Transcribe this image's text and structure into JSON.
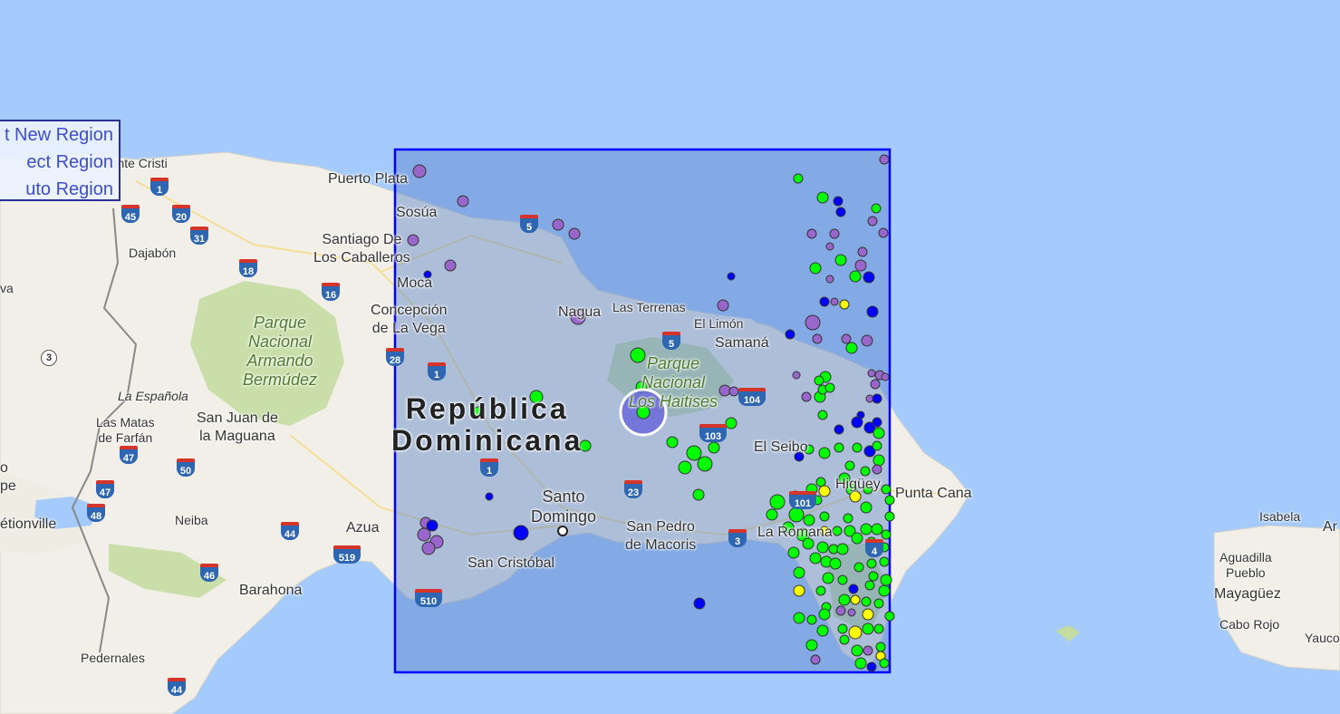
{
  "menu": {
    "items": [
      "t New Region",
      "ect Region",
      "uto Region"
    ]
  },
  "map": {
    "labels": {
      "monte_cristi": "Monte Cristi",
      "puerto_plata": "Puerto Plata",
      "sosua": "Sosúa",
      "santiago": "Santiago De\nLos Caballeros",
      "moca": "Moca",
      "concepcion": "Concepción\nde La Vega",
      "nagua": "Nagua",
      "las_terrenas": "Las Terrenas",
      "el_limon": "El Limón",
      "samana": "Samaná",
      "dajabon": "Dajabón",
      "la_espanola": "La Española",
      "las_matas": "Las Matas\nde Farfán",
      "san_juan": "San Juan de\nla Maguana",
      "azua": "Azua",
      "neiba": "Neiba",
      "barahona": "Barahona",
      "pedernales": "Pedernales",
      "etionville": "étionville",
      "edge_va": "va",
      "edge_o": "o",
      "edge_pe": "pe",
      "santo_domingo": "Santo\nDomingo",
      "san_cristobal": "San Cristóbal",
      "san_pedro": "San Pedro\nde Macoris",
      "la_romana": "La Romana",
      "el_seibo": "El Seibo",
      "higuey": "Higüey",
      "punta_cana": "Punta Cana",
      "isabela": "Isabela",
      "aguadilla": "Aguadilla\nPueblo",
      "mayaguez": "Mayagüez",
      "cabo_rojo": "Cabo Rojo",
      "yauco": "Yauco",
      "edge_ar": "Ar",
      "country": "República\nDominicana",
      "park_armando": "Parque\nNacional\nArmando\nBermúdez",
      "park_haitises": "Parque\nNacional\nLos Haitises"
    },
    "shields": [
      "1",
      "45",
      "20",
      "31",
      "18",
      "16",
      "5",
      "28",
      "1",
      "5",
      "104",
      "103",
      "1",
      "23",
      "3",
      "4",
      "510",
      "3",
      "47",
      "50",
      "47",
      "48",
      "44",
      "519",
      "46",
      "44",
      "101"
    ],
    "colors": {
      "water": "#a4cbfb",
      "land": "#f1efe8",
      "park": "#c4dca2",
      "selection_fill": "#5a82c8",
      "selection_border": "#0000ff",
      "quake_green": "#00ff00",
      "quake_purple": "#9966cc",
      "quake_blue": "#0000ff",
      "quake_yellow": "#ffff00"
    }
  }
}
